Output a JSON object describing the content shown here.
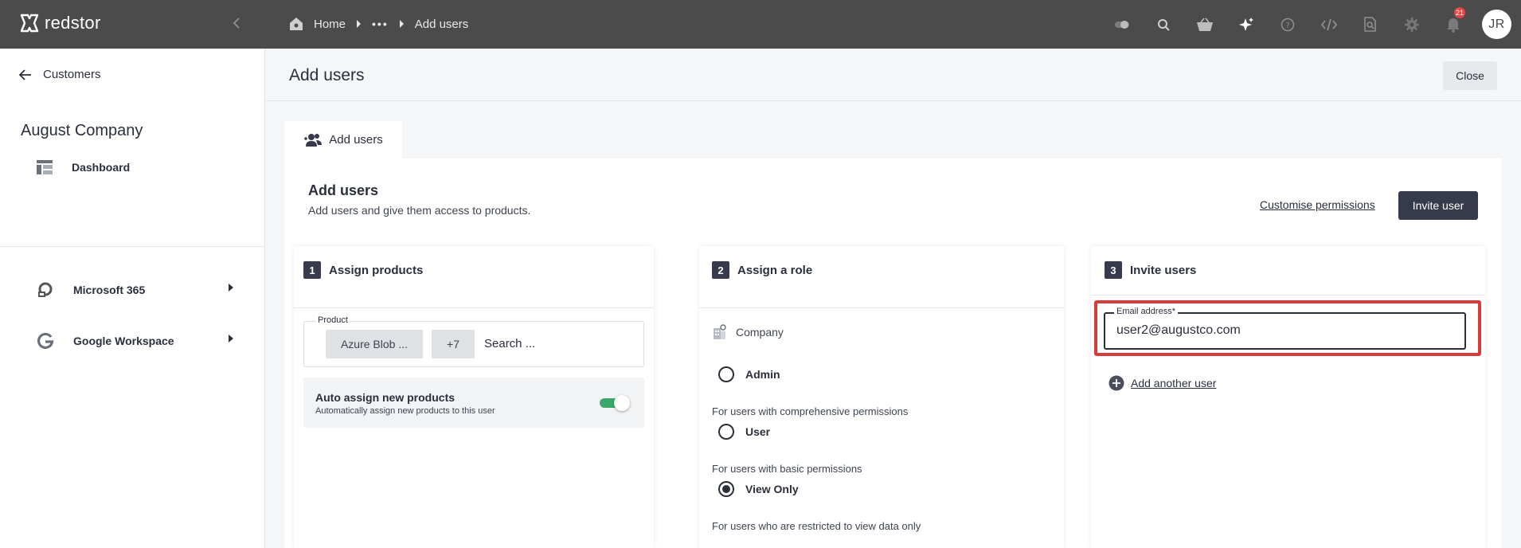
{
  "topbar": {
    "brand": "redstor",
    "breadcrumb": {
      "home": "Home",
      "ellipsis": "•••",
      "current": "Add users"
    },
    "notifications_count": "21",
    "avatar_initials": "JR"
  },
  "sidebar": {
    "back_label": "Customers",
    "company_name": "August Company",
    "items": [
      {
        "label": "Dashboard",
        "icon": "dashboard-icon"
      },
      {
        "label": "Microsoft 365",
        "icon": "microsoft-365-icon"
      },
      {
        "label": "Google Workspace",
        "icon": "google-icon"
      }
    ]
  },
  "page": {
    "title": "Add users",
    "close_label": "Close"
  },
  "tab": {
    "label": "Add users"
  },
  "card": {
    "title": "Add users",
    "subtitle": "Add users and give them access to products.",
    "customise_label": "Customise permissions",
    "invite_label": "Invite user"
  },
  "step1": {
    "number": "1",
    "title": "Assign products",
    "product_label": "Product",
    "chip_product": "Azure Blob ...",
    "chip_more": "+7",
    "search_placeholder": "Search ...",
    "auto_title": "Auto assign new products",
    "auto_sub": "Automatically assign new products to this user",
    "auto_enabled": true
  },
  "step2": {
    "number": "2",
    "title": "Assign a role",
    "scope": "Company",
    "roles": [
      {
        "label": "Admin",
        "desc": "For users with comprehensive permissions",
        "selected": false
      },
      {
        "label": "User",
        "desc": "For users with basic permissions",
        "selected": false
      },
      {
        "label": "View Only",
        "desc": "For users who are restricted to view data only",
        "selected": true
      }
    ]
  },
  "step3": {
    "number": "3",
    "title": "Invite users",
    "email_label": "Email address*",
    "email_value": "user2@augustco.com",
    "add_another": "Add another user"
  },
  "colors": {
    "topbar": "#4b4b4b",
    "primary": "#363a4a",
    "toggle_on": "#3aa86b",
    "highlight": "#d93a3a",
    "badge": "#e04848"
  }
}
